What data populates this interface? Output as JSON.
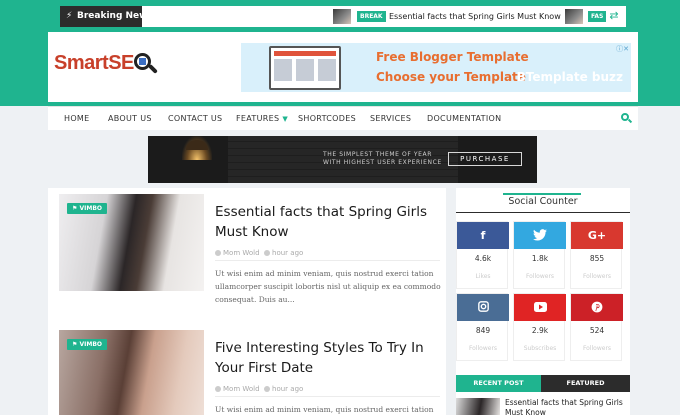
{
  "breaking": {
    "label": "Breaking News",
    "items": [
      {
        "badge": "BREAK",
        "text": "Essential facts that Spring Girls Must Know"
      },
      {
        "badge": "FAS",
        "text": ""
      }
    ]
  },
  "header": {
    "logo_text": "SmartSE",
    "ad": {
      "line1": "Free Blogger Template",
      "line2": "Choose your Template",
      "brand": "BTemplate buzz",
      "close": "ⓘ✕"
    }
  },
  "nav": {
    "items": [
      {
        "label": "HOME"
      },
      {
        "label": "ABOUT US"
      },
      {
        "label": "CONTACT US"
      },
      {
        "label": "FEATURES",
        "has_dropdown": true
      },
      {
        "label": "SHORTCODES"
      },
      {
        "label": "SERVICES"
      },
      {
        "label": "DOCUMENTATION"
      }
    ]
  },
  "banner": {
    "line1": "THE SIMPLEST THEME OF YEAR",
    "line2": "WITH HIGHEST USER EXPERIENCE",
    "button": "PURCHASE"
  },
  "posts": [
    {
      "category": "VIMBO",
      "title": "Essential facts that Spring Girls Must Know",
      "author": "Mom Wold",
      "time": "hour ago",
      "excerpt": "Ut wisi enim ad minim veniam, quis nostrud exerci tation ullamcorper suscipit lobortis nisl ut aliquip ex ea commodo consequat. Duis au..."
    },
    {
      "category": "VIMBO",
      "title": "Five Interesting Styles To Try In Your First Date",
      "author": "Mom Wold",
      "time": "hour ago",
      "excerpt": "Ut wisi enim ad minim veniam, quis nostrud exerci tation ullamcorper suscipit lobortis nisl ut aliquip ex"
    }
  ],
  "sidebar": {
    "title": "Social Counter",
    "social": [
      {
        "icon": "f",
        "count": "4.6k",
        "label": "Likes",
        "color": "#3b5998"
      },
      {
        "icon": "t",
        "count": "1.8k",
        "label": "Followers",
        "color": "#33a8e0"
      },
      {
        "icon": "G+",
        "count": "855",
        "label": "Followers",
        "color": "#d8382f"
      },
      {
        "icon": "ig",
        "count": "849",
        "label": "Followers",
        "color": "#4a6d95"
      },
      {
        "icon": "yt",
        "count": "2.9k",
        "label": "Subscribes",
        "color": "#e02424"
      },
      {
        "icon": "p",
        "count": "524",
        "label": "Followers",
        "color": "#cc2127"
      }
    ],
    "tabs": [
      {
        "label": "RECENT POST",
        "color": "#1fb48f"
      },
      {
        "label": "FEATURED",
        "color": "#2c2c2c"
      }
    ],
    "recent_post": {
      "title": "Essential facts that Spring Girls Must Know"
    }
  },
  "colors": {
    "accent": "#1fb48f",
    "dark": "#2c2c2c",
    "logo": "#c8402a"
  }
}
